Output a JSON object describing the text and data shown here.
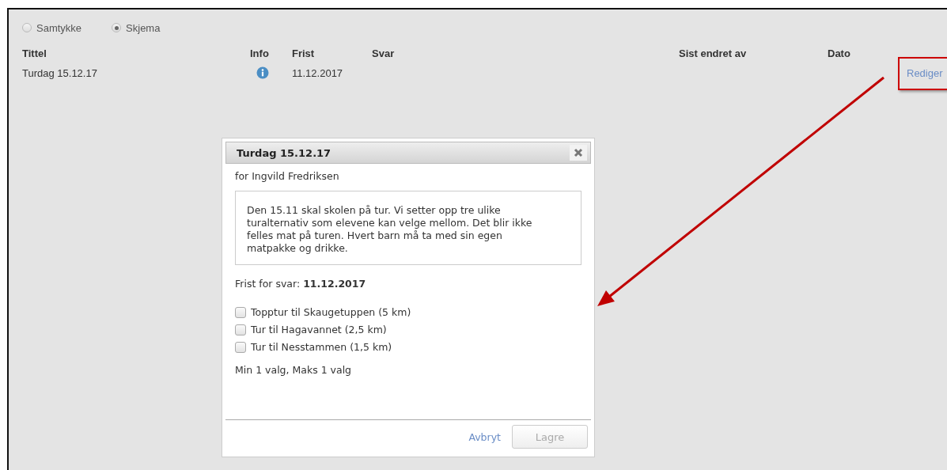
{
  "modes": [
    {
      "label": "Samtykke",
      "selected": false
    },
    {
      "label": "Skjema",
      "selected": true
    }
  ],
  "table": {
    "columns": [
      "Tittel",
      "Info",
      "Frist",
      "Svar",
      "Sist endret av",
      "Dato"
    ],
    "rows": [
      {
        "title": "Turdag 15.12.17",
        "deadline": "11.12.2017",
        "action": "Rediger",
        "highlighted": true
      }
    ]
  },
  "dialog": {
    "title": "Turdag 15.12.17",
    "recipient": "for Ingvild Fredriksen",
    "message": "Den 15.11 skal skolen på tur. Vi setter opp tre ulike turalternativ som elevene kan velge mellom. Det blir ikke felles mat på turen. Hvert barn må ta med sin egen matpakke og drikke.",
    "deadline": "Frist for svar: **11.12.2017**",
    "options": [
      {
        "label": "Topptur til Skaugetuppen (5 km)",
        "checked": false
      },
      {
        "label": "Tur til Hagavannet (2,5 km)",
        "checked": false
      },
      {
        "label": "Tur til Nesstammen (1,5 km)",
        "checked": false
      }
    ],
    "constraint": "Min 1 valg, Maks 1 valg",
    "cancel": "Avbryt",
    "save": {
      "label": "Lagre",
      "disabled": true
    }
  }
}
